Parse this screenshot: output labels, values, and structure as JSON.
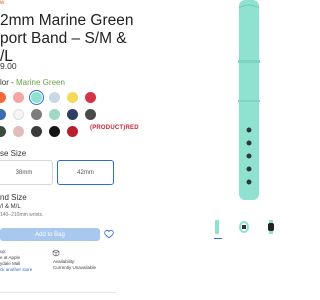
{
  "product": {
    "badge": "w",
    "title": "2mm Marine Green\nport Band – S/M &\n/L",
    "price": "9.00"
  },
  "color_selector": {
    "label": "lor - ",
    "selected_value": "Marine Green",
    "swatches": [
      {
        "name": "orange",
        "color": "#f26b3a"
      },
      {
        "name": "pink",
        "color": "#f3a7a5"
      },
      {
        "name": "marine-green",
        "color": "#8fe2cf",
        "selected": true
      },
      {
        "name": "light-blue",
        "color": "#c9d8e8"
      },
      {
        "name": "yellow",
        "color": "#f5d95a"
      },
      {
        "name": "red",
        "color": "#d63347"
      },
      {
        "name": "blue",
        "color": "#3d6cb0"
      },
      {
        "name": "white",
        "color": "#f4f4f4"
      },
      {
        "name": "gray",
        "color": "#7c7c7c"
      },
      {
        "name": "mint",
        "color": "#9fd8c6"
      },
      {
        "name": "navy",
        "color": "#2d3e61"
      },
      {
        "name": "dark-gray",
        "color": "#4a4a4a"
      },
      {
        "name": "dark-green",
        "color": "#384c3c"
      },
      {
        "name": "blush",
        "color": "#e0bcbc"
      },
      {
        "name": "charcoal",
        "color": "#3a3a3a"
      },
      {
        "name": "black",
        "color": "#141414"
      },
      {
        "name": "product-red",
        "color": "#b91f2b"
      }
    ],
    "product_red_label": "(PRODUCT)RED"
  },
  "case_size": {
    "label": "se Size",
    "options": [
      "38mm",
      "42mm"
    ],
    "selected": "42mm"
  },
  "band_size": {
    "label": "nd Size",
    "value": "/I & M/L",
    "fit_note": "140–210mm wrists."
  },
  "actions": {
    "add_to_bag": "Add to Bag"
  },
  "pickup": {
    "label": "up:",
    "store_line": "e at Apple",
    "store_name": "ydale Mall",
    "link": "ck another store"
  },
  "availability": {
    "label": "Availability:",
    "status": "Currently Unavailable"
  },
  "colors": {
    "accent": "#2f6bd8",
    "band": "#8fe2cf",
    "add_to_bag_disabled": "#a9c8ee"
  },
  "images": {
    "thumbnails": [
      "band-front",
      "band-side",
      "band-watch"
    ]
  }
}
